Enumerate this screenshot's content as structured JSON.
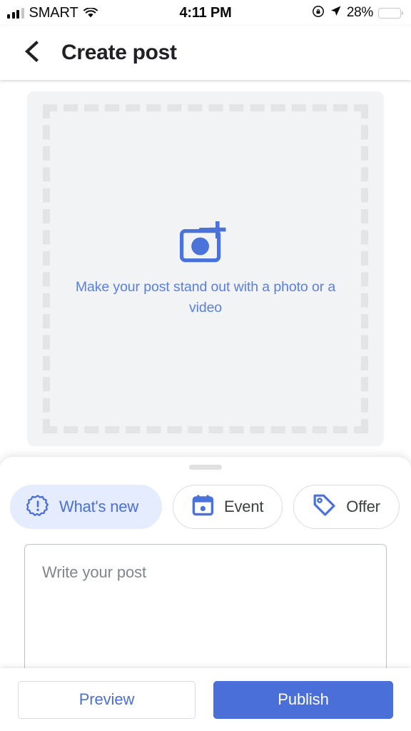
{
  "status_bar": {
    "carrier": "SMART",
    "time": "4:11 PM",
    "battery_percent": "28%",
    "icons": {
      "signal": "signal-bars-icon",
      "wifi": "wifi-icon",
      "rotation_lock": "rotation-lock-icon",
      "location": "location-arrow-icon",
      "battery": "battery-icon"
    }
  },
  "header": {
    "back_icon": "back-chevron-icon",
    "title": "Create post"
  },
  "media": {
    "icon": "add-photo-icon",
    "hint": "Make your post stand out with a photo or a video",
    "hint_color": "#5b7fe0"
  },
  "sheet": {
    "handle": "drag-handle",
    "chips": [
      {
        "label": "What's new",
        "icon": "whats-new-badge-icon",
        "selected": true
      },
      {
        "label": "Event",
        "icon": "calendar-icon",
        "selected": false
      },
      {
        "label": "Offer",
        "icon": "tag-icon",
        "selected": false
      }
    ],
    "composer": {
      "placeholder": "Write your post",
      "value": ""
    }
  },
  "footer": {
    "preview_label": "Preview",
    "publish_label": "Publish"
  },
  "colors": {
    "accent": "#4a6fd8",
    "chip_selected_bg": "#e5ecfd",
    "card_bg": "#f1f3f4",
    "dash": "#e2e4e5"
  }
}
